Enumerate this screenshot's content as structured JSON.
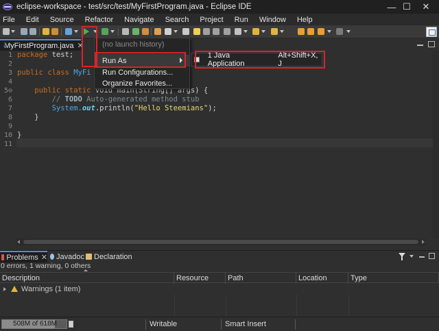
{
  "window": {
    "title": "eclipse-workspace - test/src/test/MyFirstProgram.java - Eclipse IDE",
    "controls": {
      "minimize": "—",
      "maximize": "☐",
      "close": "✕"
    }
  },
  "menubar": [
    "File",
    "Edit",
    "Source",
    "Refactor",
    "Navigate",
    "Search",
    "Project",
    "Run",
    "Window",
    "Help"
  ],
  "editor": {
    "tab": {
      "label": "MyFirstProgram.java",
      "close": "✕"
    },
    "line_numbers": [
      "1",
      "2",
      "3",
      "4",
      "5⊖",
      "6",
      "7",
      "8",
      "9",
      "10",
      "11"
    ],
    "code": {
      "l1_kw": "package",
      "l1_rest": " test;",
      "l3_kw1": "public",
      "l3_kw2": "class",
      "l3_cls": "MyFi",
      "l5_lead": "    ",
      "l5_kw1": "public",
      "l5_kw2": "static",
      "l5_tail": "void main(String[] args) {",
      "l6_lead": "        ",
      "l6_slashes": "// ",
      "l6_todo": "TODO",
      "l6_rest": " Auto-generated method stub",
      "l7_lead": "        ",
      "l7_sys": "System.",
      "l7_out": "out",
      "l7_call": ".println(",
      "l7_str": "\"Hello Steemians\"",
      "l7_end": ");",
      "l8": "    }",
      "l10": "}"
    }
  },
  "run_menu": {
    "items": [
      {
        "label": "(no launch history)",
        "enabled": false
      },
      {
        "label": "Run As",
        "enabled": true,
        "has_submenu": true
      },
      {
        "label": "Run Configurations...",
        "enabled": true
      },
      {
        "label": "Organize Favorites...",
        "enabled": true
      }
    ]
  },
  "run_as_submenu": {
    "label": "1 Java Application",
    "accelerator": "Alt+Shift+X, J"
  },
  "panel": {
    "tabs": [
      {
        "label": "Problems",
        "active": true
      },
      {
        "label": "Javadoc",
        "active": false
      },
      {
        "label": "Declaration",
        "active": false
      }
    ],
    "summary": "0 errors, 1 warning, 0 others",
    "columns": [
      "Description",
      "Resource",
      "Path",
      "Location",
      "Type"
    ],
    "rows": [
      {
        "label": "Warnings (1 item)"
      }
    ]
  },
  "statusbar": {
    "heap": "508M of 618M",
    "heap_fraction": 0.82,
    "writable": "Writable",
    "insert_mode": "Smart Insert"
  },
  "colors": {
    "highlight_box": "#d9232a",
    "run_icon": "#47b34a",
    "keyword": "#cc6c1d",
    "string": "#e6db74",
    "active_tab_accent": "#4d8fd6"
  }
}
